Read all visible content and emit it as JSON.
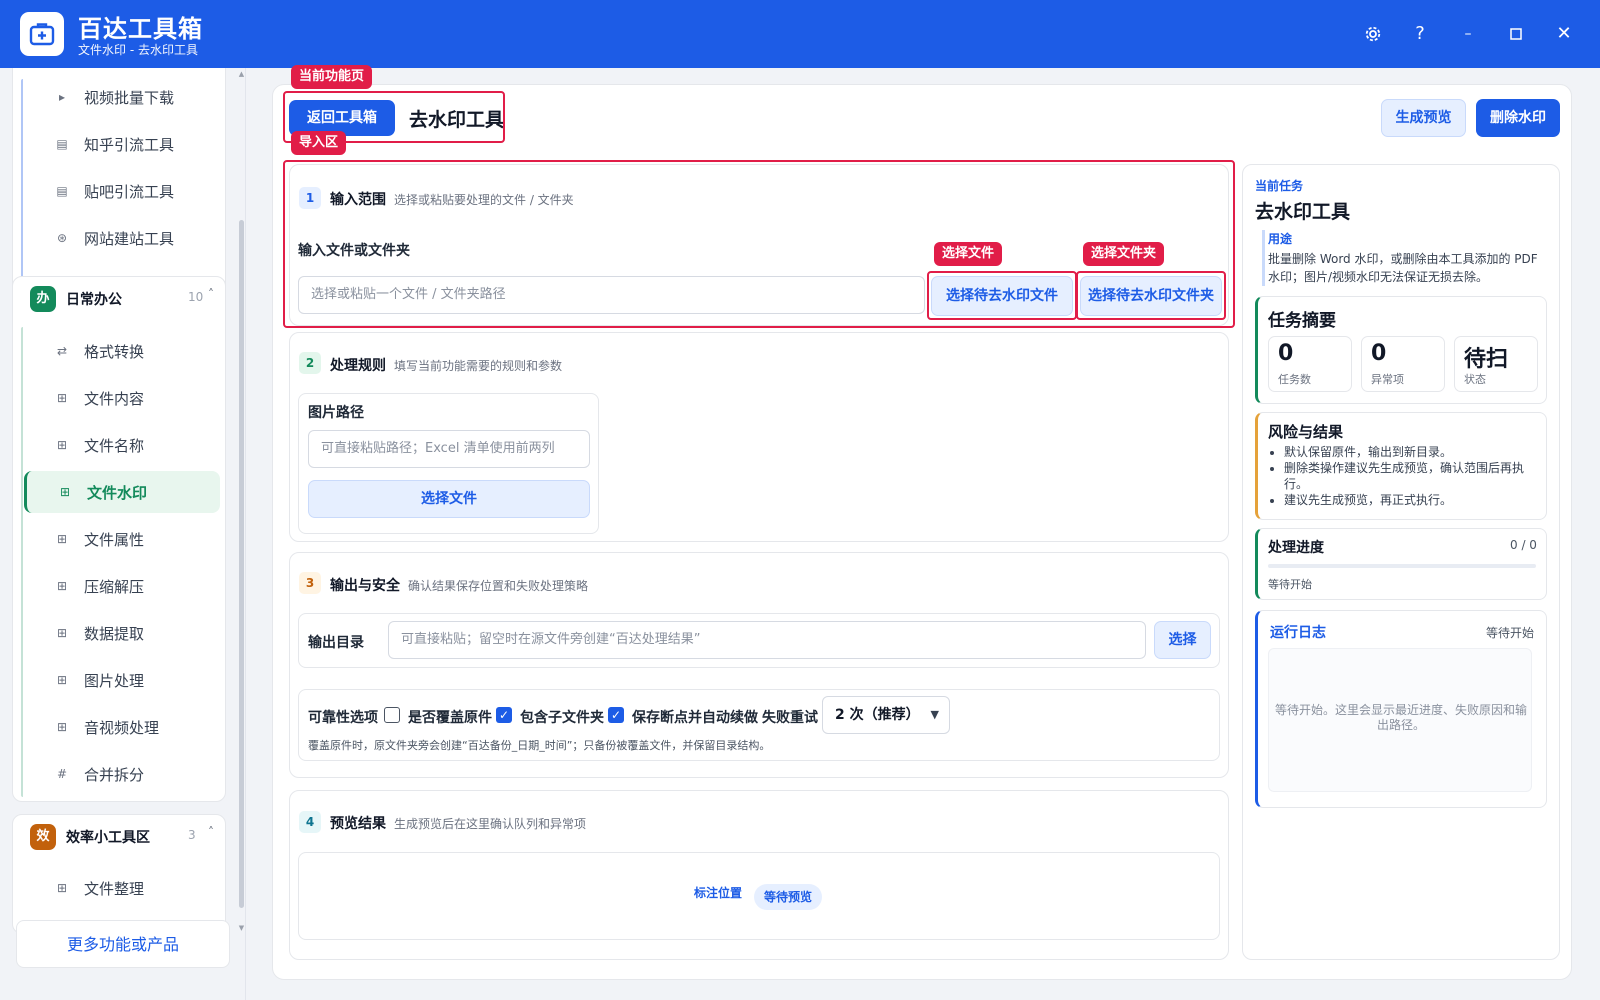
{
  "app": {
    "title": "百达工具箱",
    "subtitle": "文件水印 - 去水印工具"
  },
  "sidebar": {
    "top_items": [
      {
        "label": "视频批量下载",
        "icon": "video-icon"
      },
      {
        "label": "知乎引流工具",
        "icon": "doc-icon"
      },
      {
        "label": "贴吧引流工具",
        "icon": "doc-icon"
      },
      {
        "label": "网站建站工具",
        "icon": "globe-icon"
      }
    ],
    "group_office": {
      "badge": "办",
      "name": "日常办公",
      "count": "10",
      "caret": "˄"
    },
    "office_items": [
      {
        "label": "格式转换",
        "icon": "⇄"
      },
      {
        "label": "文件内容",
        "icon": "⊞"
      },
      {
        "label": "文件名称",
        "icon": "⊞"
      },
      {
        "label": "文件水印",
        "icon": "⊞"
      },
      {
        "label": "文件属性",
        "icon": "⊞"
      },
      {
        "label": "压缩解压",
        "icon": "⊞"
      },
      {
        "label": "数据提取",
        "icon": "⊞"
      },
      {
        "label": "图片处理",
        "icon": "⊞"
      },
      {
        "label": "音视频处理",
        "icon": "⊞"
      },
      {
        "label": "合并拆分",
        "icon": "#"
      }
    ],
    "group_efficiency": {
      "badge": "效",
      "name": "效率小工具区",
      "count": "3",
      "caret": "˄"
    },
    "efficiency_items": [
      {
        "label": "文件整理",
        "icon": "⊞"
      }
    ],
    "more_label": "更多功能或产品"
  },
  "header": {
    "tag_current": "当前功能页",
    "back_label": "返回工具箱",
    "tool_title": "去水印工具",
    "preview_label": "生成预览",
    "remove_label": "删除水印"
  },
  "section1": {
    "tag_import": "导入区",
    "num": "1",
    "title": "输入范围",
    "desc": "选择或粘贴要处理的文件 / 文件夹",
    "field_label": "输入文件或文件夹",
    "placeholder": "选择或粘贴一个文件 / 文件夹路径",
    "tag_file": "选择文件",
    "tag_folder": "选择文件夹",
    "pick_file_label": "选择待去水印文件",
    "pick_folder_label": "选择待去水印文件夹"
  },
  "section2": {
    "num": "2",
    "title": "处理规则",
    "desc": "填写当前功能需要的规则和参数",
    "image_label": "图片路径",
    "image_placeholder": "可直接粘贴路径；Excel 清单使用前两列",
    "pick_label": "选择文件"
  },
  "section3": {
    "num": "3",
    "title": "输出与安全",
    "desc": "确认结果保存位置和失败处理策略",
    "out_label": "输出目录",
    "out_placeholder": "可直接粘贴；留空时在源文件旁创建“百达处理结果”",
    "out_pick": "选择",
    "reliability_label": "可靠性选项",
    "opt_overwrite": "是否覆盖原件",
    "opt_subfolder": "包含子文件夹",
    "opt_resume": "保存断点并自动续做",
    "retry_label": "失败重试",
    "retry_value": "2 次（推荐）",
    "note": "覆盖原件时，原文件夹旁会创建“百达备份_日期_时间”；只备份被覆盖文件，并保留目录结构。",
    "checkmark": "✓"
  },
  "section4": {
    "num": "4",
    "title": "预览结果",
    "desc": "生成预览后在这里确认队列和异常项",
    "mark_label": "标注位置",
    "status_badge": "等待预览"
  },
  "panel": {
    "task_kicker": "当前任务",
    "task_title": "去水印工具",
    "usage_label": "用途",
    "usage_text": "批量删除 Word 水印，或删除由本工具添加的 PDF 水印；图片/视频水印无法保证无损去除。",
    "summary_title": "任务摘要",
    "stats": [
      {
        "value": "0",
        "label": "任务数"
      },
      {
        "value": "0",
        "label": "异常项"
      },
      {
        "value": "待扫",
        "label": "状态"
      }
    ],
    "risk_title": "风险与结果",
    "risk_items": [
      "默认保留原件，输出到新目录。",
      "删除类操作建议先生成预览，确认范围后再执行。",
      "建议先生成预览，再正式执行。"
    ],
    "progress_title": "处理进度",
    "progress_count": "0 / 0",
    "progress_fraction": 0,
    "progress_status": "等待开始",
    "log_title": "运行日志",
    "log_status": "等待开始",
    "log_placeholder": "等待开始。这里会显示最近进度、失败原因和输出路径。"
  },
  "colors": {
    "brand": "#1d5ce6",
    "annotation": "#e11d48",
    "active_green": "#138a5b"
  }
}
